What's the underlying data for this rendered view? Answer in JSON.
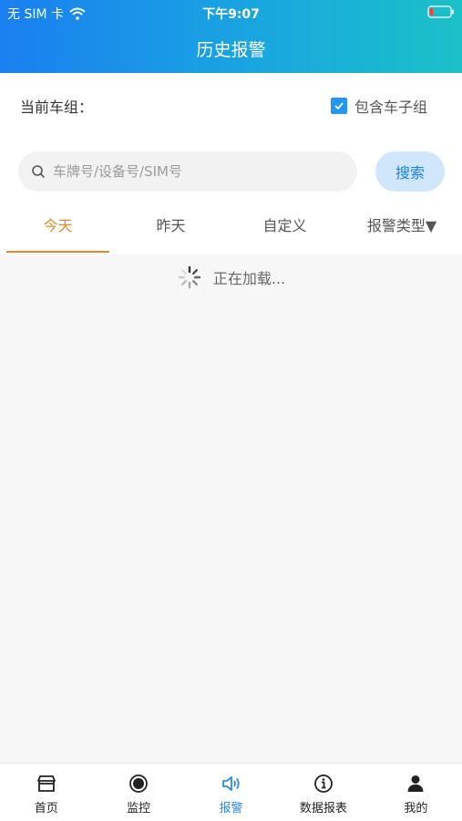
{
  "status_bar": {
    "carrier": "无 SIM 卡",
    "time": "下午9:07"
  },
  "header": {
    "title": "历史报警"
  },
  "group": {
    "label": "当前车组：",
    "include_sub_label": "包含车子组",
    "include_sub_checked": true
  },
  "search": {
    "placeholder": "车牌号/设备号/SIM号",
    "value": "",
    "button_label": "搜索"
  },
  "tabs": [
    {
      "label": "今天",
      "active": true
    },
    {
      "label": "昨天",
      "active": false
    },
    {
      "label": "自定义",
      "active": false
    },
    {
      "label": "报警类型▼",
      "active": false
    }
  ],
  "loading_text": "正在加载...",
  "tabbar": [
    {
      "label": "首页",
      "icon": "store-icon",
      "active": false
    },
    {
      "label": "监控",
      "icon": "record-icon",
      "active": false
    },
    {
      "label": "报警",
      "icon": "speaker-icon",
      "active": true
    },
    {
      "label": "数据报表",
      "icon": "info-icon",
      "active": false
    },
    {
      "label": "我的",
      "icon": "user-icon",
      "active": false
    }
  ],
  "colors": {
    "header_start": "#1a7ff0",
    "header_end": "#1bc1c7",
    "accent_orange": "#e38a2c",
    "accent_blue": "#2a8ae6"
  }
}
